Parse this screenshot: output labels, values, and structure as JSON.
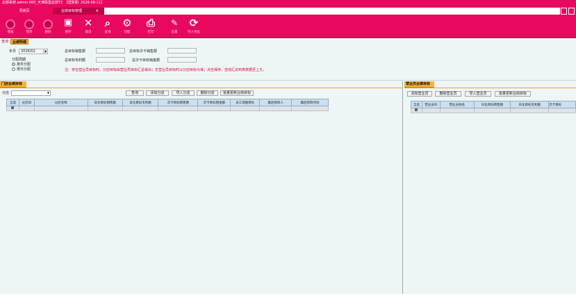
{
  "window": {
    "title": "总部系统.admin:000_天津联盟总部T2　【营账期: 2026-08-11】"
  },
  "tabs": [
    {
      "label": "导航页"
    },
    {
      "label": "业绩目标管理",
      "close": "×"
    }
  ],
  "toolbar": {
    "items": [
      {
        "label": "增加",
        "icon": "add-icon"
      },
      {
        "label": "修改",
        "icon": "edit-icon"
      },
      {
        "label": "删除",
        "icon": "delete-icon"
      },
      {
        "label": "保存",
        "icon": "save-icon",
        "glyph": "💾"
      },
      {
        "label": "取消",
        "icon": "cancel-icon",
        "glyph": "✕"
      },
      {
        "label": "查询",
        "icon": "search-icon",
        "glyph": "⌕"
      },
      {
        "label": "功能",
        "icon": "gear-icon",
        "glyph": "⚙"
      },
      {
        "label": "打印",
        "icon": "print-icon",
        "glyph": "⎙"
      },
      {
        "label": "设置",
        "icon": "wrench-icon",
        "glyph": "🔧"
      },
      {
        "label": "导入导出",
        "icon": "refresh-icon",
        "glyph": "⟳"
      }
    ]
  },
  "subtabs": {
    "query": "查询",
    "detail": "业绩明细"
  },
  "filters": {
    "month_label": "年月",
    "month_value": "2026/02",
    "period_label": "分配周期",
    "opt_month": "按月分配",
    "opt_day": "按日分配",
    "total_sales_label": "总目标销售额",
    "total_margin_label": "总目标毛利额",
    "total_card_count_label": "总目标次卡销售额",
    "total_card_amount_label": "总次卡目标销金额",
    "note": "注：存在营业员目标时，分店目标由营业员目标汇总得出；无营业员目标时以分店目标为准；点击保存，自动汇总到表数据至上方。"
  },
  "store_panel": {
    "title": "门店业绩目标",
    "store_label": "分店",
    "buttons": [
      "查询",
      "添加分店",
      "导入分店",
      "删除分店",
      "批量更新业绩目标"
    ],
    "columns": [
      "全选",
      "分店ID",
      "分店名称",
      "日化目标销售额",
      "日化目标毛利额",
      "次卡目标销售数",
      "次卡目标销金额",
      "员工现额目标",
      "最后修改人",
      "最后修改时间"
    ]
  },
  "staff_panel": {
    "title": "营业员业绩目标",
    "buttons": [
      "添加营业员",
      "删除营业员",
      "导入营业员",
      "批量更新业绩目标"
    ],
    "columns": [
      "全选",
      "营业员ID",
      "营业员姓名",
      "日化目标销售额",
      "日化目标毛利额",
      "次卡目标"
    ]
  },
  "colors": {
    "brand": "#e8095f",
    "panel_title": "#f7b437",
    "grid_header": "#c9e0f2",
    "note": "#e00030"
  }
}
